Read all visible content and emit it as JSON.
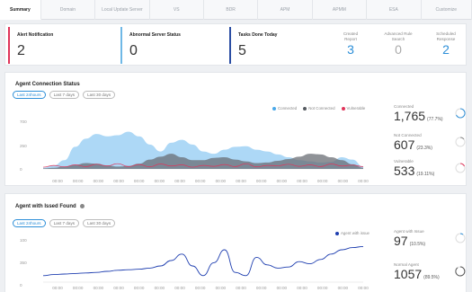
{
  "tabs": [
    {
      "label": "Summary"
    },
    {
      "label": "Domain"
    },
    {
      "label": "Local Update Server"
    },
    {
      "label": "VS"
    },
    {
      "label": "BDR"
    },
    {
      "label": "APM"
    },
    {
      "label": "APMM"
    },
    {
      "label": "ESA"
    },
    {
      "label": "Customize"
    }
  ],
  "stats": {
    "alert": {
      "label": "Alert Notification",
      "value": "2",
      "color": "#e0345a"
    },
    "server": {
      "label": "Abnormal Server Status",
      "value": "0",
      "color": "#6fb8e6"
    },
    "tasks": {
      "label": "Tasks Done Today",
      "value": "5",
      "color": "#2b4ea3"
    },
    "created": {
      "label": "Created Report",
      "value": "3"
    },
    "rule": {
      "label": "Advanced Rule Search",
      "value": "0"
    },
    "scheduled": {
      "label": "Scheduled Response",
      "value": "2"
    }
  },
  "connection": {
    "title": "Agent Connection Status",
    "pills": [
      "Last 24hours",
      "Last 7 days",
      "Last 30 days"
    ],
    "legend": [
      {
        "name": "Connected",
        "color": "#4aa8e8"
      },
      {
        "name": "Not Connected",
        "color": "#555a60"
      },
      {
        "name": "Vulnerable",
        "color": "#e0345a"
      }
    ],
    "side": [
      {
        "label": "Connected",
        "value": "1,765",
        "pct": "(77.7%)",
        "color": "#2d8fd8"
      },
      {
        "label": "Not Connected",
        "value": "607",
        "pct": "(23.3%)",
        "color": "#999999"
      },
      {
        "label": "Vulnerable",
        "value": "533",
        "pct": "(19.11%)",
        "color": "#e0345a"
      }
    ]
  },
  "issue": {
    "title": "Agent with Issed Found",
    "pills": [
      "Last 24hours",
      "Last 7 days",
      "Last 30 days"
    ],
    "legend": [
      {
        "name": "Agent with issue",
        "color": "#1f3fb0"
      }
    ],
    "side": [
      {
        "label": "Agent with Issue",
        "value": "97",
        "pct": "(10.5%)",
        "color": "#2d8fd8"
      },
      {
        "label": "Normal Agent",
        "value": "1057",
        "pct": "(89.5%)",
        "color": "#999999"
      }
    ]
  },
  "chart_data": [
    {
      "type": "area",
      "title": "Agent Connection Status",
      "categories": [
        "00:00",
        "00:00",
        "00:00",
        "00:00",
        "00:00",
        "00:00",
        "00:00",
        "00:00",
        "00:00",
        "00:00",
        "00:00",
        "00:00",
        "00:00",
        "00:00",
        "00:00",
        "00:00"
      ],
      "yticks": [
        700,
        250,
        0
      ],
      "ylim": [
        0,
        850
      ],
      "x": [
        0,
        1,
        2,
        3,
        4,
        5,
        6,
        7,
        8,
        9,
        10,
        11,
        12,
        13,
        14,
        15,
        16,
        17,
        18,
        19,
        20,
        21,
        22,
        23,
        24,
        25,
        26,
        27,
        28,
        29,
        30
      ],
      "series": [
        {
          "name": "Connected",
          "values": [
            20,
            60,
            150,
            380,
            520,
            600,
            560,
            580,
            640,
            560,
            420,
            300,
            450,
            500,
            420,
            300,
            260,
            330,
            380,
            390,
            330,
            300,
            250,
            200,
            150,
            130,
            110,
            120,
            200,
            160,
            40
          ]
        },
        {
          "name": "Not Connected",
          "values": [
            10,
            20,
            40,
            70,
            100,
            90,
            60,
            40,
            50,
            90,
            160,
            210,
            260,
            200,
            150,
            150,
            190,
            200,
            160,
            130,
            100,
            110,
            140,
            170,
            210,
            260,
            250,
            200,
            150,
            80,
            20
          ]
        },
        {
          "name": "Vulnerable",
          "values": [
            30,
            60,
            35,
            70,
            40,
            80,
            50,
            90,
            40,
            75,
            35,
            85,
            50,
            70,
            30,
            60,
            45,
            75,
            40,
            90,
            35,
            60,
            55,
            80,
            45,
            70,
            40,
            85,
            50,
            65,
            40
          ]
        }
      ]
    },
    {
      "type": "line",
      "title": "Agent with Issed Found",
      "categories": [
        "00:00",
        "00:00",
        "00:00",
        "00:00",
        "00:00",
        "00:00",
        "00:00",
        "00:00",
        "00:00",
        "00:00",
        "00:00",
        "00:00",
        "00:00",
        "00:00",
        "00:00",
        "00:00"
      ],
      "yticks": [
        100,
        350,
        0
      ],
      "ylim": [
        0,
        400
      ],
      "x": [
        0,
        1,
        2,
        3,
        4,
        5,
        6,
        7,
        8,
        9,
        10,
        11,
        12,
        13,
        14,
        15,
        16,
        17,
        18,
        19,
        20,
        21,
        22,
        23,
        24,
        25,
        26,
        27,
        28,
        29,
        30
      ],
      "series": [
        {
          "name": "Agent with issue",
          "values": [
            60,
            70,
            75,
            80,
            85,
            90,
            100,
            110,
            115,
            120,
            130,
            150,
            200,
            260,
            150,
            60,
            180,
            300,
            90,
            60,
            230,
            160,
            130,
            140,
            190,
            170,
            210,
            260,
            300,
            320,
            330
          ]
        }
      ]
    }
  ]
}
